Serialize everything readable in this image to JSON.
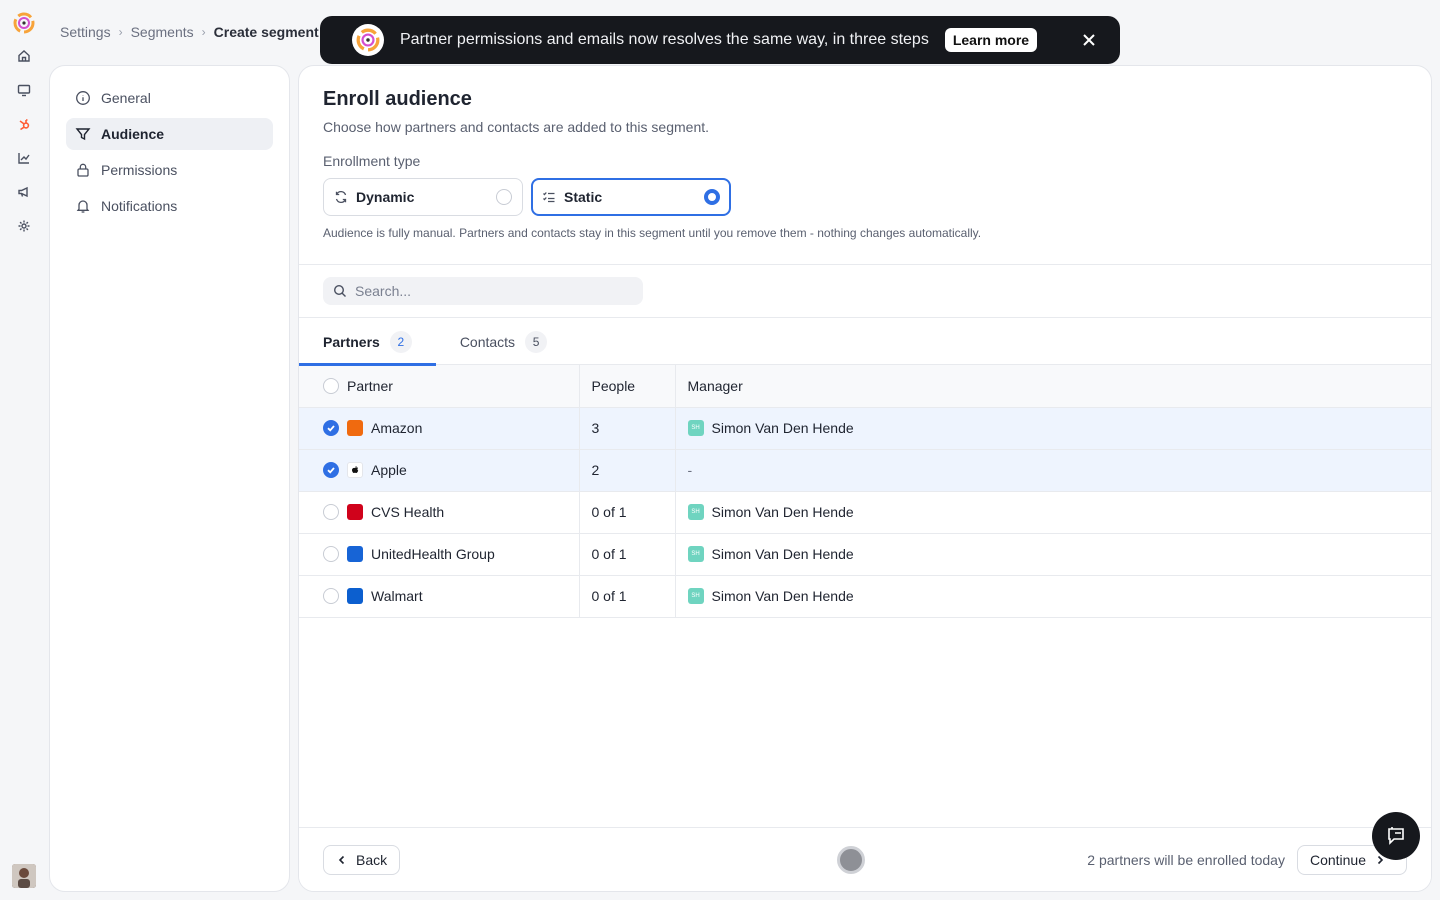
{
  "breadcrumb": [
    "Settings",
    "Segments",
    "Create segment"
  ],
  "sidebar": {
    "items": [
      {
        "label": "General"
      },
      {
        "label": "Audience"
      },
      {
        "label": "Permissions"
      },
      {
        "label": "Notifications"
      }
    ]
  },
  "toast": {
    "message": "Partner permissions and emails now resolves the same way, in three steps",
    "action": "Learn more"
  },
  "main": {
    "title": "Enroll audience",
    "subtitle": "Choose how partners and contacts are added to this segment.",
    "enrollment_label": "Enrollment type",
    "options": [
      {
        "label": "Dynamic",
        "selected": false
      },
      {
        "label": "Static",
        "selected": true
      }
    ],
    "hint": "Audience is fully manual. Partners and contacts stay in this segment until you remove them - nothing changes automatically.",
    "search_placeholder": "Search...",
    "tabs": [
      {
        "label": "Partners",
        "count": "2"
      },
      {
        "label": "Contacts",
        "count": "5"
      }
    ],
    "table": {
      "headers": [
        "Partner",
        "People",
        "Manager"
      ],
      "rows": [
        {
          "partner": "Amazon",
          "people": "3",
          "manager": "Simon Van Den Hende",
          "checked": true,
          "color": "#f06a0f"
        },
        {
          "partner": "Apple",
          "people": "2",
          "manager": "-",
          "checked": true,
          "color": "#ffffff"
        },
        {
          "partner": "CVS Health",
          "people": "0 of 1",
          "manager": "Simon Van Den Hende",
          "checked": false,
          "color": "#d0021b"
        },
        {
          "partner": "UnitedHealth Group",
          "people": "0 of 1",
          "manager": "Simon Van Den Hende",
          "checked": false,
          "color": "#1764d6"
        },
        {
          "partner": "Walmart",
          "people": "0 of 1",
          "manager": "Simon Van Den Hende",
          "checked": false,
          "color": "#0c5fcf"
        }
      ],
      "manager_initials": "SH"
    },
    "footer": {
      "back": "Back",
      "note": "2 partners will be enrolled today",
      "continue": "Continue"
    }
  }
}
